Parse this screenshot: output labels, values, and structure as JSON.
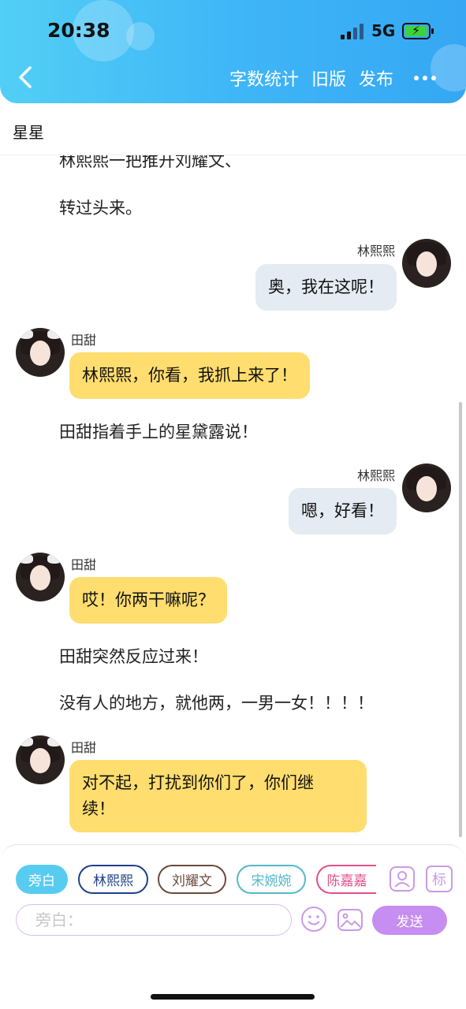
{
  "status_bar": {
    "time": "20:38",
    "network": "5G"
  },
  "header": {
    "actions": [
      "字数统计",
      "旧版",
      "发布"
    ]
  },
  "story": {
    "title": "星星"
  },
  "messages": {
    "narr_partial": "林熙熙一把推开刘耀文、",
    "narr_1": "转过头来。",
    "m1": {
      "speaker": "林熙熙",
      "text": "奥，我在这呢！"
    },
    "m2": {
      "speaker": "田甜",
      "text": "林熙熙，你看，我抓上来了！"
    },
    "narr_2": "田甜指着手上的星黛露说！",
    "m3": {
      "speaker": "林熙熙",
      "text": "嗯，好看！"
    },
    "m4": {
      "speaker": "田甜",
      "text": "哎！你两干嘛呢？"
    },
    "narr_3": "田甜突然反应过来！",
    "narr_4": "没有人的地方，就他两，一男一女！！！！",
    "m5": {
      "speaker": "田甜",
      "text_line1": "对不起，打扰到你们了，你们继",
      "text_line2": "续！"
    }
  },
  "roles": [
    {
      "label": "旁白",
      "color": "#58cbf0"
    },
    {
      "label": "林熙熙",
      "color": "#1f3f8a"
    },
    {
      "label": "刘耀文",
      "color": "#6b4a3a"
    },
    {
      "label": "宋婉婉",
      "color": "#55b8c9"
    },
    {
      "label": "陈嘉嘉",
      "color": "#e0508a"
    }
  ],
  "tools": {
    "mark_label": "标"
  },
  "composer": {
    "placeholder": "旁白：",
    "value": "",
    "send_label": "发送"
  }
}
